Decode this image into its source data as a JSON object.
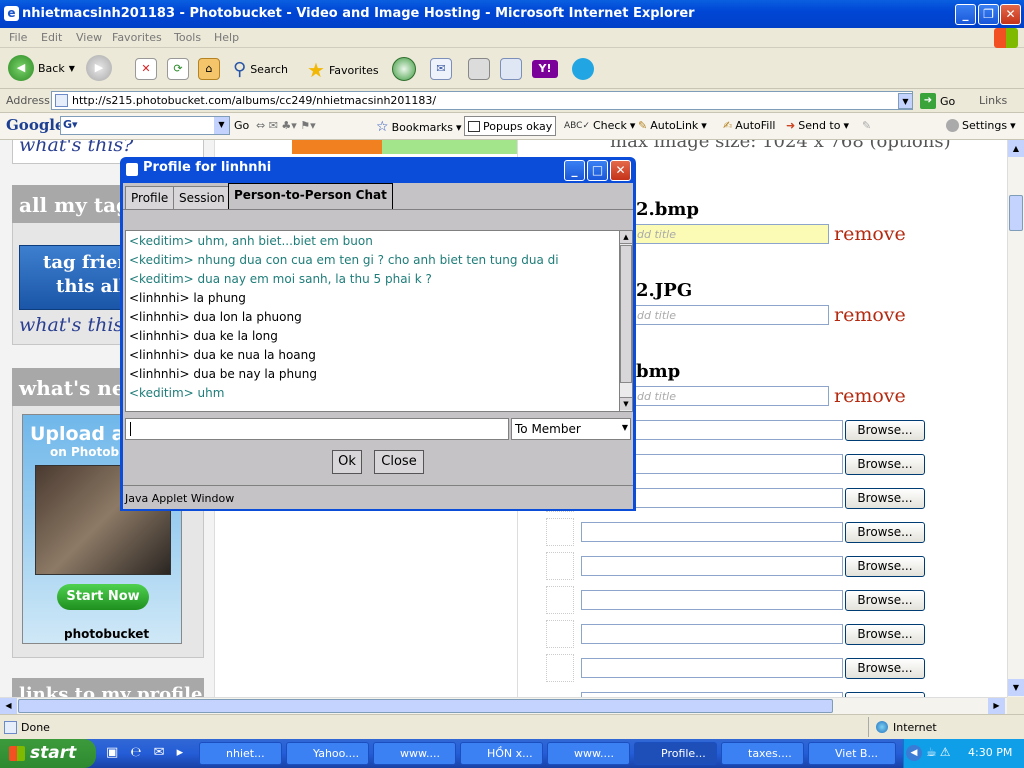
{
  "window": {
    "title": "nhietmacsinh201183 - Photobucket - Video and Image Hosting - Microsoft Internet Explorer"
  },
  "menu": [
    "File",
    "Edit",
    "View",
    "Favorites",
    "Tools",
    "Help"
  ],
  "toolbar": {
    "back": "Back",
    "search": "Search",
    "favorites": "Favorites"
  },
  "address": {
    "label": "Address",
    "url": "http://s215.photobucket.com/albums/cc249/nhietmacsinh201183/",
    "go": "Go",
    "links": "Links"
  },
  "google_bar": {
    "logo": "Google",
    "go": "Go",
    "bookmarks": "Bookmarks",
    "popups": "Popups okay",
    "check": "Check",
    "autolink": "AutoLink",
    "autofill": "AutoFill",
    "sendto": "Send to",
    "settings": "Settings"
  },
  "page": {
    "whats_this_top": "what's this?",
    "tags_head": "all my tag",
    "tag_friends": "tag frien",
    "this_album": "this alb",
    "whats_this": "what's this?",
    "whats_new": "what's ne",
    "ad_upload": "Upload a",
    "ad_on": "on Photob",
    "ad_start": "Start Now",
    "ad_brand": "photobucket",
    "links_profile": "links to my profile",
    "max_size": "max image size: 1024 x 768 (options)",
    "files": [
      {
        "name": "2.bmp",
        "placeholder": "dd title"
      },
      {
        "name": "2.JPG",
        "placeholder": "dd title"
      },
      {
        "name": "bmp",
        "placeholder": "dd title"
      }
    ],
    "remove": "remove",
    "browse": "Browse..."
  },
  "dialog": {
    "title": "Profile for linhnhi",
    "tabs": [
      "Profile",
      "Session",
      "Person-to-Person Chat"
    ],
    "messages": [
      {
        "from": "keditim",
        "text": "<keditim> uhm, anh biet...biet em buon"
      },
      {
        "from": "keditim",
        "text": "<keditim> nhung dua con cua em ten gi ? cho anh biet ten tung dua di"
      },
      {
        "from": "keditim",
        "text": "<keditim> dua nay em moi sanh, la thu 5 phai k ?"
      },
      {
        "from": "linhnhi",
        "text": "<linhnhi>  la phung"
      },
      {
        "from": "linhnhi",
        "text": "<linhnhi>  dua lon la phuong"
      },
      {
        "from": "linhnhi",
        "text": "<linhnhi>  dua ke la long"
      },
      {
        "from": "linhnhi",
        "text": "<linhnhi>  dua ke nua la hoang"
      },
      {
        "from": "linhnhi",
        "text": "<linhnhi>  dua be nay la phung"
      },
      {
        "from": "keditim",
        "text": "<keditim> uhm"
      }
    ],
    "recipient": "To Member",
    "ok": "Ok",
    "close": "Close",
    "java_note": "Java Applet Window"
  },
  "status": {
    "text": "Done",
    "zone": "Internet"
  },
  "taskbar": {
    "start": "start",
    "tasks": [
      "nhiet...",
      "Yahoo....",
      "www....",
      "HỒN x...",
      "www....",
      "Profile...",
      "taxes....",
      "Viet B..."
    ],
    "clock": "4:30 PM"
  },
  "colors": {
    "keditim": "#1f7d79",
    "linhnhi": "#000000",
    "xp_blue": "#0046d5",
    "remove": "#b42a10"
  }
}
